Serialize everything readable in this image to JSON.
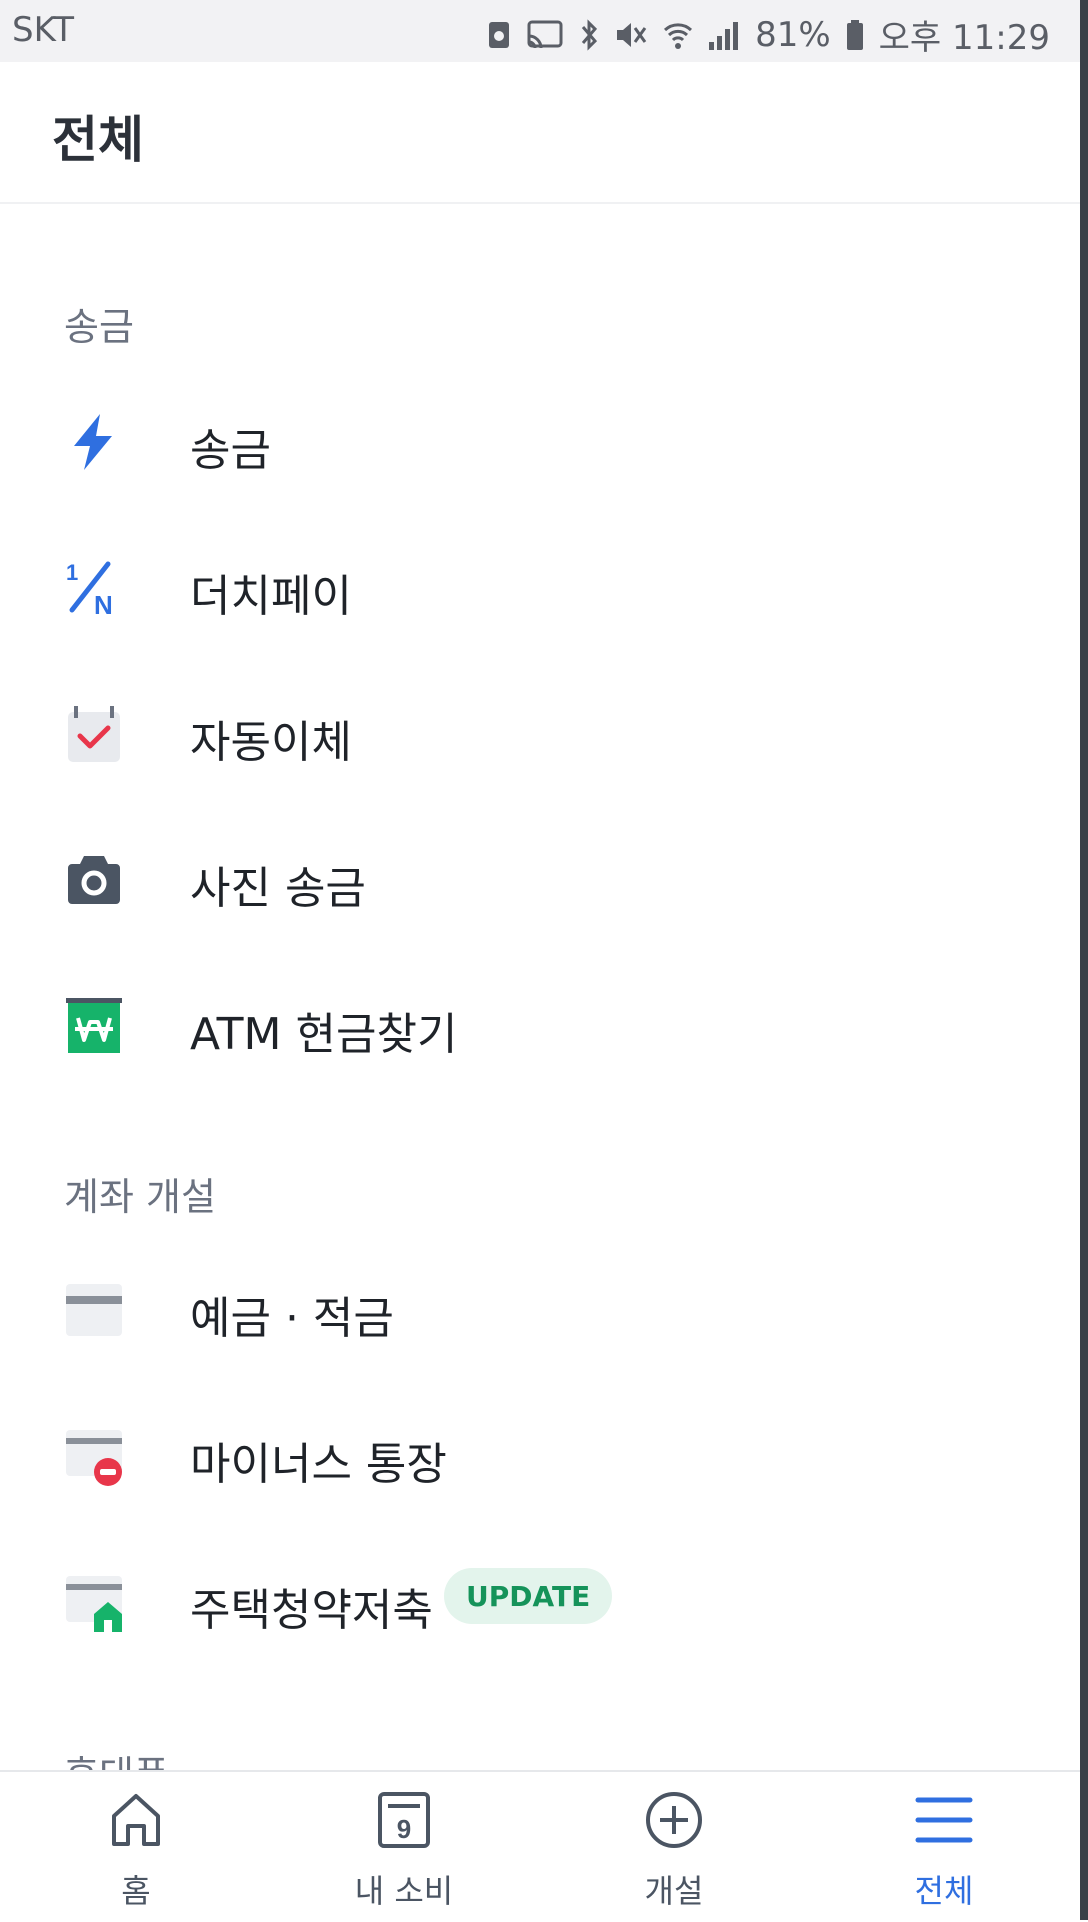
{
  "status_bar": {
    "carrier": "SKT",
    "battery": "81%",
    "time": "오후 11:29"
  },
  "header": {
    "title": "전체"
  },
  "sections": [
    {
      "title": "송금",
      "items": [
        {
          "label": "송금",
          "icon": "lightning-icon"
        },
        {
          "label": "더치페이",
          "icon": "one-over-n-icon"
        },
        {
          "label": "자동이체",
          "icon": "calendar-check-icon"
        },
        {
          "label": "사진 송금",
          "icon": "camera-icon"
        },
        {
          "label": "ATM 현금찾기",
          "icon": "won-atm-icon"
        }
      ]
    },
    {
      "title": "계좌 개설",
      "items": [
        {
          "label": "예금 · 적금",
          "icon": "card-icon"
        },
        {
          "label": "마이너스 통장",
          "icon": "card-minus-icon"
        },
        {
          "label": "주택청약저축",
          "icon": "card-house-icon",
          "badge": "UPDATE"
        }
      ]
    },
    {
      "title": "휴대폰"
    }
  ],
  "bottom_nav": {
    "items": [
      {
        "label": "홈",
        "icon": "home-icon"
      },
      {
        "label": "내 소비",
        "icon": "calendar-nine-icon",
        "icon_text": "9"
      },
      {
        "label": "개설",
        "icon": "plus-circle-icon"
      },
      {
        "label": "전체",
        "icon": "menu-icon",
        "active": true
      }
    ]
  },
  "colors": {
    "accent_blue": "#2f6fe0",
    "green": "#16b36a",
    "red": "#e8364a",
    "badge_bg": "#e3f4ec",
    "badge_text": "#15935a"
  }
}
